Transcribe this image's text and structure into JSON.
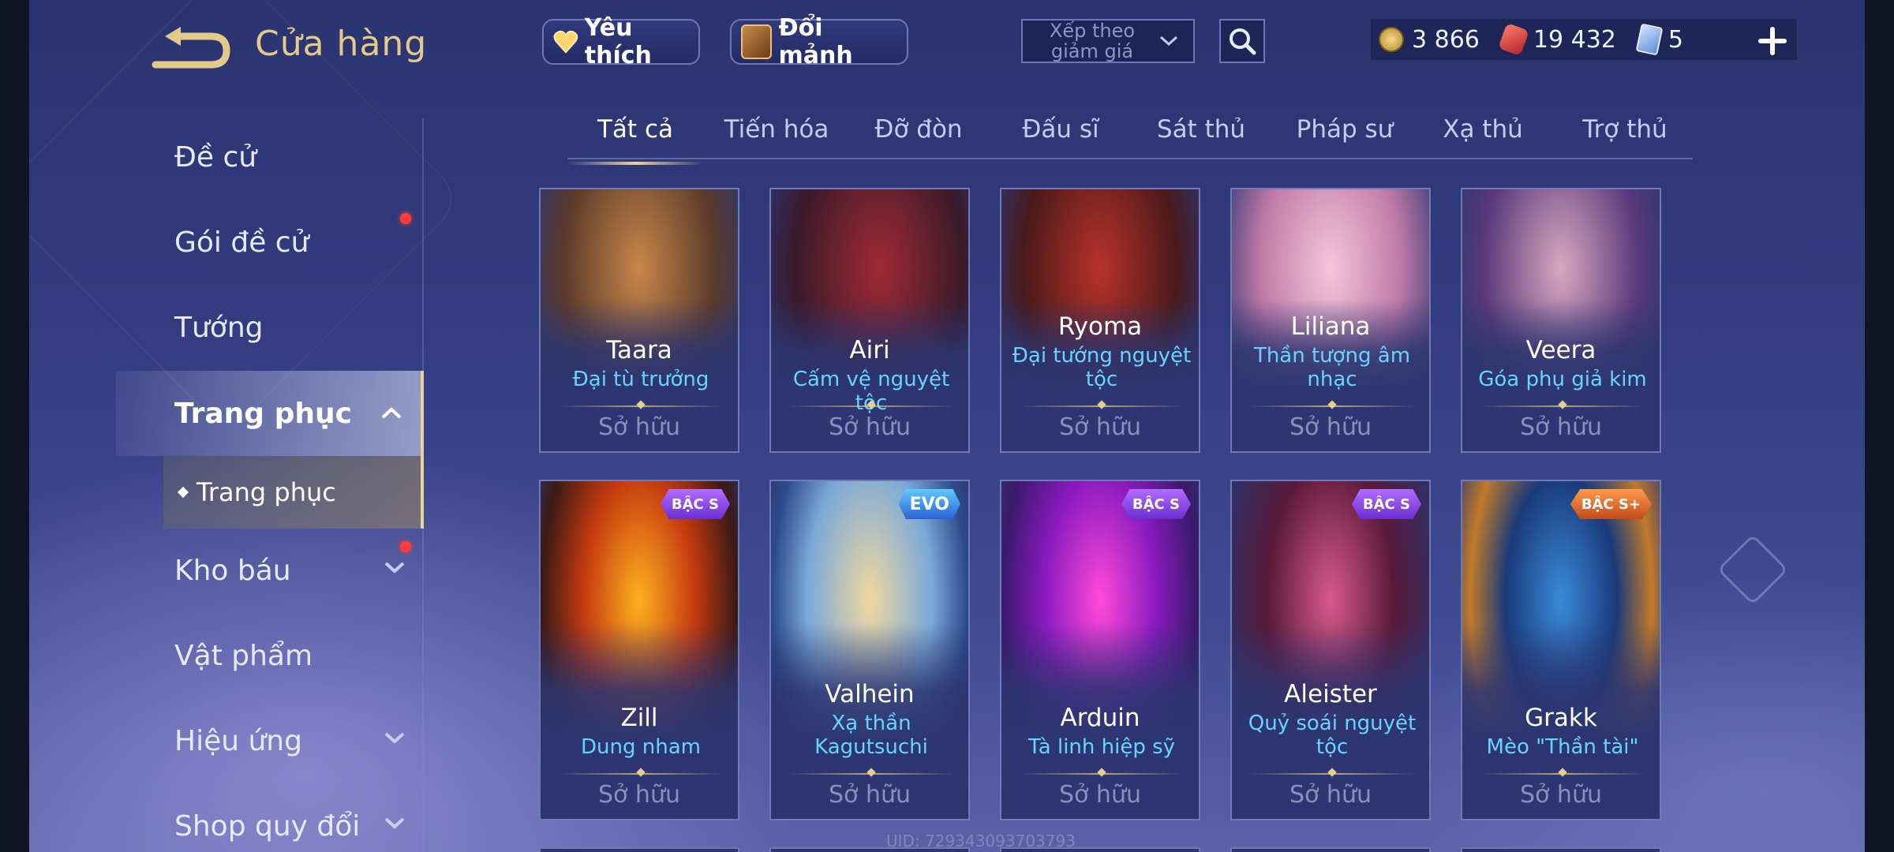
{
  "header": {
    "title": "Cửa hàng",
    "favorite_label": "Yêu thích",
    "shard_label": "Đổi mảnh",
    "sort_label": "Xếp theo giảm giá",
    "currencies": [
      {
        "icon": "gold-coin-icon",
        "value": "3 866"
      },
      {
        "icon": "voucher-icon",
        "value": "19 432"
      },
      {
        "icon": "card-icon",
        "value": "5"
      }
    ]
  },
  "sidebar": {
    "items": [
      {
        "label": "Đề cử"
      },
      {
        "label": "Gói đề cử",
        "notification": true
      },
      {
        "label": "Tướng"
      },
      {
        "label": "Trang phục",
        "active": true,
        "expanded": true
      },
      {
        "label": "Kho báu",
        "notification": true
      },
      {
        "label": "Vật phẩm"
      },
      {
        "label": "Hiệu ứng"
      },
      {
        "label": "Shop quy đổi"
      }
    ],
    "sub_item": "Trang phục"
  },
  "tabs": [
    "Tất cả",
    "Tiến hóa",
    "Đỡ đòn",
    "Đấu sĩ",
    "Sát thủ",
    "Pháp sư",
    "Xạ thủ",
    "Trợ thủ"
  ],
  "cards": [
    {
      "hero": "Taara",
      "skin": "Đại tù trưởng",
      "status": "Sở hữu",
      "badge": ""
    },
    {
      "hero": "Airi",
      "skin": "Cấm vệ nguyệt tộc",
      "status": "Sở hữu",
      "badge": ""
    },
    {
      "hero": "Ryoma",
      "skin": "Đại tướng nguyệt tộc",
      "status": "Sở hữu",
      "badge": ""
    },
    {
      "hero": "Liliana",
      "skin": "Thần tượng âm nhạc",
      "status": "Sở hữu",
      "badge": ""
    },
    {
      "hero": "Veera",
      "skin": "Góa phụ giả kim",
      "status": "Sở hữu",
      "badge": ""
    },
    {
      "hero": "Zill",
      "skin": "Dung nham",
      "status": "Sở hữu",
      "badge": "BẬC S"
    },
    {
      "hero": "Valhein",
      "skin": "Xạ thần Kagutsuchi",
      "status": "Sở hữu",
      "badge": "EVO"
    },
    {
      "hero": "Arduin",
      "skin": "Tà linh hiệp sỹ",
      "status": "Sở hữu",
      "badge": "BẬC S"
    },
    {
      "hero": "Aleister",
      "skin": "Quỷ soái nguyệt tộc",
      "status": "Sở hữu",
      "badge": "BẬC S"
    },
    {
      "hero": "Grakk",
      "skin": "Mèo \"Thần tài\"",
      "status": "Sở hữu",
      "badge": "BẬC S+"
    }
  ],
  "footer": {
    "uid": "UID: 729343093703793"
  },
  "colors": {
    "accent_gold": "#e9d39a",
    "skin_blue": "#66d4ff",
    "owned_grey": "#8990ba",
    "notification_red": "#ff3b3b"
  }
}
